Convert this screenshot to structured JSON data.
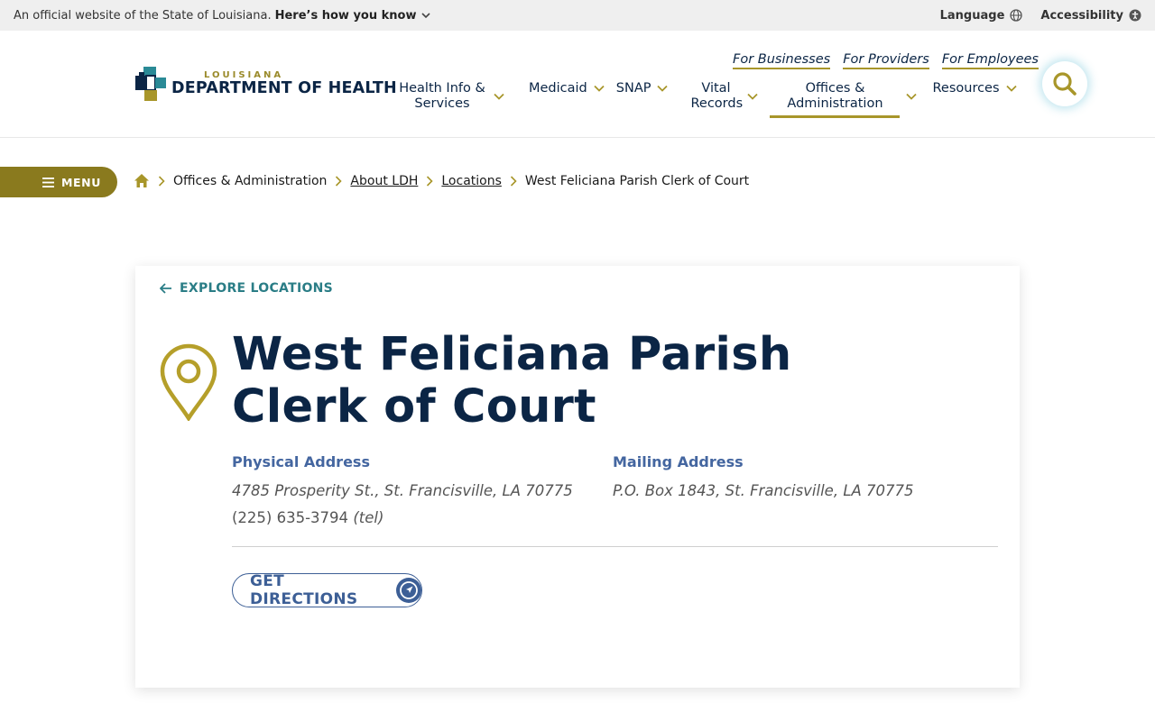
{
  "official_bar": {
    "text": "An official website of the State of Louisiana.",
    "how_you_know": "Here’s how you know",
    "language": "Language",
    "accessibility": "Accessibility"
  },
  "logo": {
    "small": "LOUISIANA",
    "big": "DEPARTMENT OF HEALTH"
  },
  "util_links": [
    "For Businesses",
    "For Providers",
    "For Employees"
  ],
  "nav": {
    "health_info": "Health Info & Services",
    "medicaid": "Medicaid",
    "snap": "SNAP",
    "vital_records": "Vital Records",
    "offices": "Offices & Administration",
    "resources": "Resources"
  },
  "menu_label": "MENU",
  "breadcrumb": {
    "item1": "Offices & Administration",
    "item2": "About LDH",
    "item3": "Locations",
    "current": "West Feliciana Parish Clerk of Court"
  },
  "card": {
    "back_link": "EXPLORE LOCATIONS",
    "title": "West Feliciana Parish Clerk of Court",
    "physical_label": "Physical Address",
    "physical_value": "4785 Prosperity St., St. Francisville, LA 70775",
    "phone": "(225) 635-3794",
    "phone_suffix": "(tel)",
    "mailing_label": "Mailing Address",
    "mailing_value": "P.O. Box 1843, St. Francisville, LA 70775",
    "directions": "GET DIRECTIONS"
  },
  "colors": {
    "navy": "#0b2545",
    "gold": "#a8962a",
    "teal": "#2a7d86",
    "blue": "#3d5f96"
  }
}
